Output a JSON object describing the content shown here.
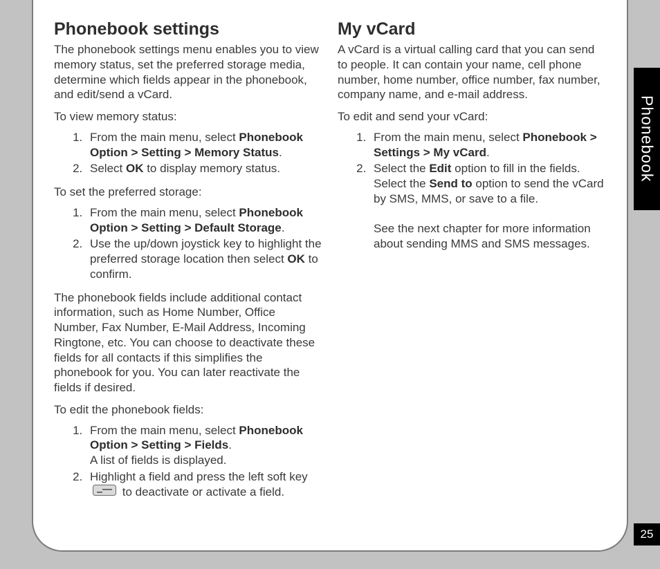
{
  "sidetab": {
    "label": "Phonebook"
  },
  "page_number": "25",
  "left": {
    "heading": "Phonebook settings",
    "intro": "The phonebook settings menu enables you to view memory status, set the preferred storage media, determine which fields appear in the phonebook, and edit/send a vCard.",
    "memstatus_lead": "To view memory status:",
    "memstatus_steps": {
      "s1_pre": "From the main menu, select ",
      "s1_bold": "Phonebook Option > Setting > Memory Status",
      "s1_post": ".",
      "s2_pre": "Select ",
      "s2_bold": "OK",
      "s2_post": " to display memory status."
    },
    "prefstorage_lead": "To set the preferred storage:",
    "prefstorage_steps": {
      "s1_pre": "From the main menu, select ",
      "s1_bold": "Phonebook Option > Setting > Default Storage",
      "s1_post": ".",
      "s2_pre": "Use the up/down joystick key to highlight the preferred storage location then select ",
      "s2_bold": "OK",
      "s2_post": " to confirm."
    },
    "fields_para": "The phonebook fields include additional contact information, such as Home Number, Office Number, Fax Number, E-Mail Address, Incoming Ringtone, etc. You can choose to deactivate these fields for all contacts if this simplifies the phonebook for you. You can later reactivate the fields if desired.",
    "fields_lead": "To edit the phonebook fields:",
    "fields_steps": {
      "s1_pre": "From the main menu, select ",
      "s1_bold": "Phonebook Option > Setting > Fields",
      "s1_post": ".",
      "s1_line2": "A list of fields is displayed.",
      "s2_pre": "Highlight a field and press the left soft key ",
      "s2_post": " to deactivate or activate a field."
    }
  },
  "right": {
    "heading": "My vCard",
    "intro": "A vCard is a virtual calling card that you can send to people. It can contain your name, cell phone number, home number, office number, fax number, company name, and e-mail address.",
    "lead": "To edit and send your vCard:",
    "steps": {
      "s1_pre": "From the main menu, select ",
      "s1_bold": "Phonebook > Settings > My vCard",
      "s1_post": ".",
      "s2_a": "Select the ",
      "s2_bold1": "Edit",
      "s2_b": " option to fill in the fields. Select the ",
      "s2_bold2": "Send to",
      "s2_c": " option to send the vCard by SMS, MMS, or save to a file.",
      "s2_note": "See the next chapter for more information about sending MMS and SMS messages."
    }
  }
}
